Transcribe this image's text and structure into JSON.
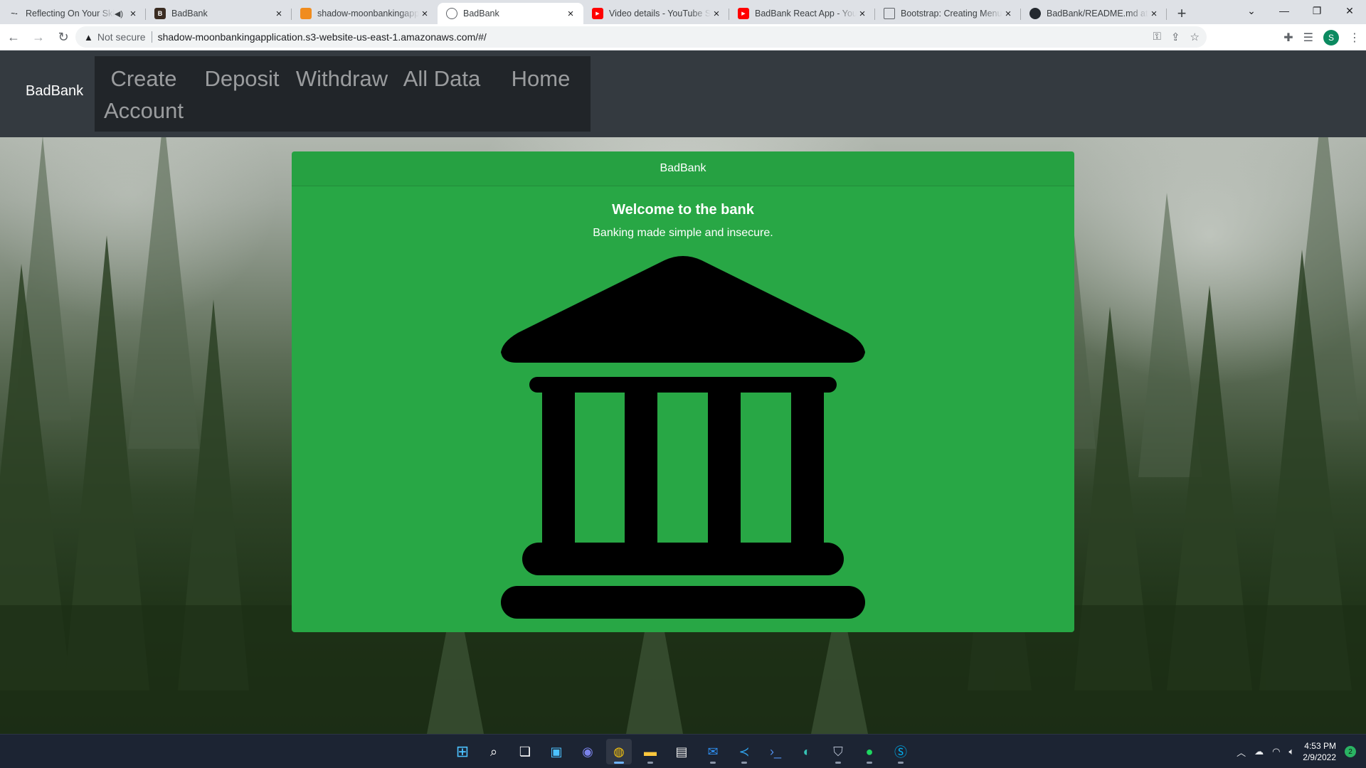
{
  "browser": {
    "tabs": [
      {
        "title": "Reflecting On Your Skills",
        "icon": "audio-wave-icon",
        "muted_icon": true,
        "active": false
      },
      {
        "title": "BadBank",
        "icon": "bb-favicon",
        "active": false
      },
      {
        "title": "shadow-moonbankingapplication",
        "icon": "aws-cube-icon",
        "active": false
      },
      {
        "title": "BadBank",
        "icon": "globe-icon",
        "active": true
      },
      {
        "title": "Video details - YouTube Studio",
        "icon": "youtube-icon",
        "active": false
      },
      {
        "title": "BadBank React App - YouTube",
        "icon": "youtube-icon",
        "active": false
      },
      {
        "title": "Bootstrap: Creating Menus",
        "icon": "doc-icon",
        "active": false
      },
      {
        "title": "BadBank/README.md at main",
        "icon": "github-icon",
        "active": false
      }
    ],
    "security_label": "Not secure",
    "url": "shadow-moonbankingapplication.s3-website-us-east-1.amazonaws.com/#/",
    "profile_initial": "S"
  },
  "navbar": {
    "brand": "BadBank",
    "items": [
      {
        "label": "Create Account"
      },
      {
        "label": "Deposit"
      },
      {
        "label": "Withdraw"
      },
      {
        "label": "All Data"
      },
      {
        "label": "Home"
      }
    ]
  },
  "card": {
    "header": "BadBank",
    "title": "Welcome to the bank",
    "text": "Banking made simple and insecure.",
    "icon": "bank-building-icon",
    "background_color": "#28a745"
  },
  "taskbar": {
    "time": "4:53 PM",
    "date": "2/9/2022",
    "notification_count": "2"
  }
}
